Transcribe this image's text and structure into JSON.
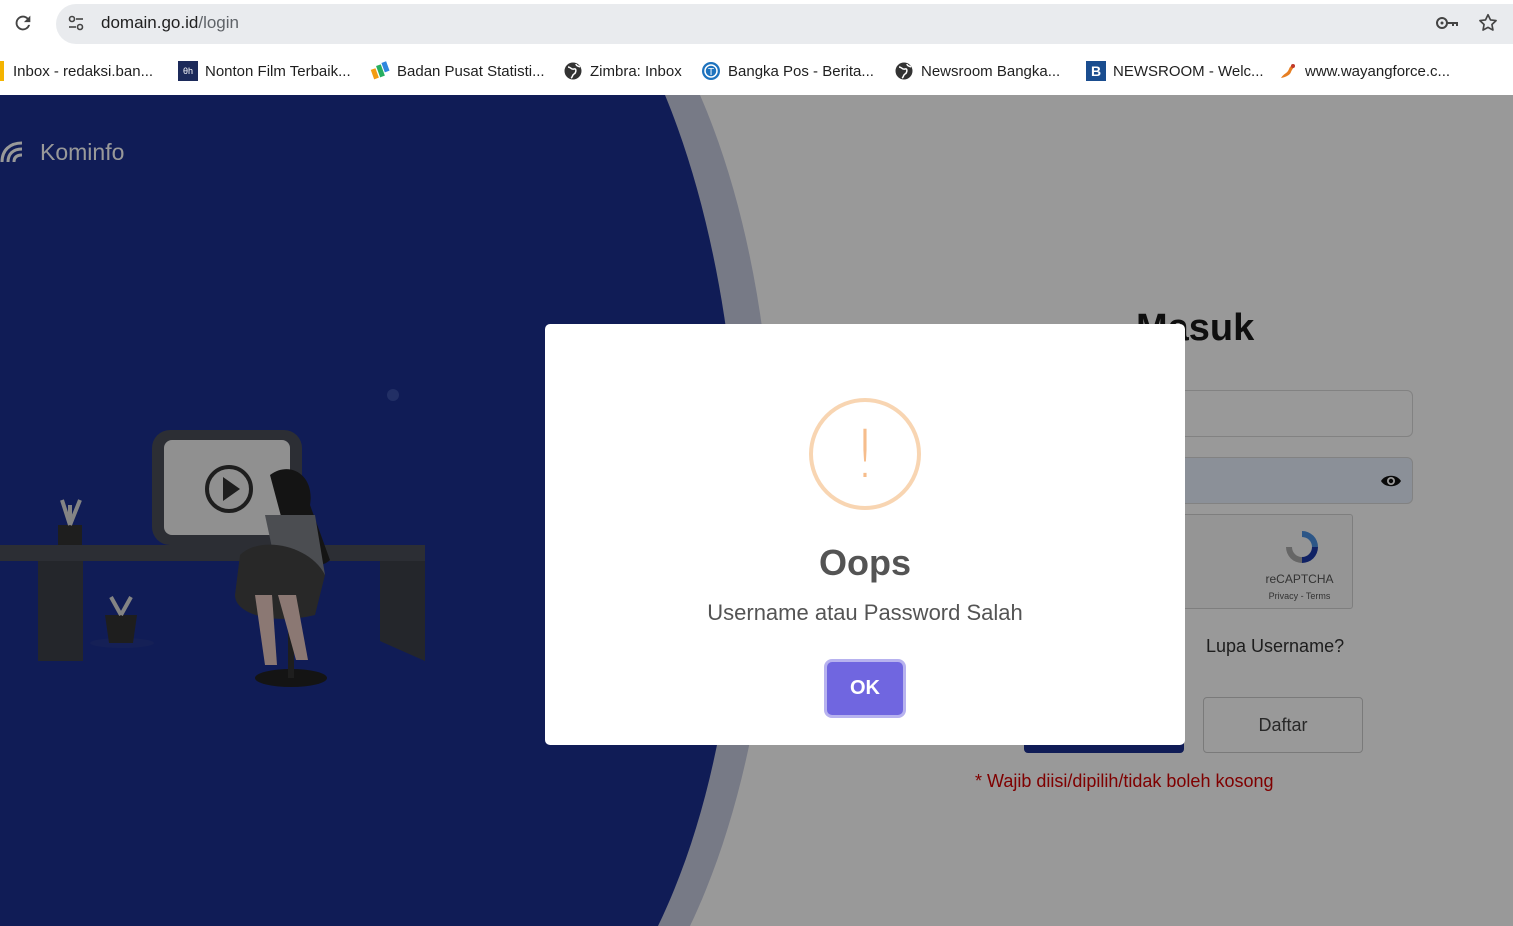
{
  "browser": {
    "url_domain": "domain.go.id",
    "url_path": "/login",
    "bookmarks": [
      {
        "label": "Inbox - redaksi.ban...",
        "icon": "gmail-icon"
      },
      {
        "label": "Nonton Film Terbaik...",
        "icon": "film-site-icon"
      },
      {
        "label": "Badan Pusat Statisti...",
        "icon": "bps-icon"
      },
      {
        "label": "Zimbra: Inbox",
        "icon": "globe-icon"
      },
      {
        "label": "Bangka Pos - Berita...",
        "icon": "tribun-icon"
      },
      {
        "label": "Newsroom Bangka...",
        "icon": "globe-icon"
      },
      {
        "label": "NEWSROOM - Welc...",
        "icon": "b-logo-icon"
      },
      {
        "label": "www.wayangforce.c...",
        "icon": "wayang-icon"
      }
    ]
  },
  "brand": {
    "name": "Kominfo"
  },
  "login": {
    "title": "Masuk",
    "forgot_username": "Lupa Username?",
    "register_label": "Daftar",
    "required_note": "* Wajib diisi/dipilih/tidak boleh kosong",
    "captcha_label": "reCAPTCHA",
    "captcha_links": "Privacy - Terms"
  },
  "modal": {
    "icon_symbol": "!",
    "title": "Oops",
    "message": "Username atau Password Salah",
    "ok_label": "OK"
  },
  "colors": {
    "left_panel": "#1b2f8f",
    "accent_button": "#7066e0",
    "warning": "#f8bb86",
    "required_text": "#d40000"
  }
}
